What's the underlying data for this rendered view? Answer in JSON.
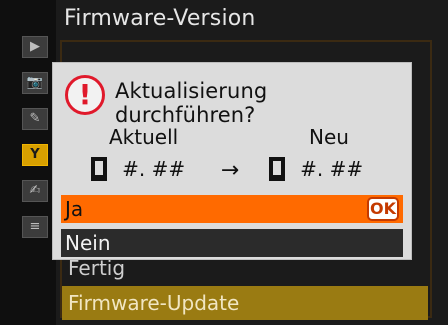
{
  "screen": {
    "title": "Firmware-Version"
  },
  "left_rail": {
    "items": [
      {
        "icon": "playback-icon",
        "symbol": "▶"
      },
      {
        "icon": "camera-icon",
        "symbol": "📷"
      },
      {
        "icon": "pencil-icon",
        "symbol": "✎"
      },
      {
        "icon": "wrench-icon",
        "symbol": "Y"
      },
      {
        "icon": "retouch-icon",
        "symbol": "✍"
      },
      {
        "icon": "my-menu-icon",
        "symbol": "≡"
      }
    ]
  },
  "background_menu": {
    "item_fertig": "Fertig",
    "item_update": "Firmware-Update"
  },
  "dialog": {
    "warning_symbol": "!",
    "title": "Aktualisierung durchführen?",
    "current_label": "Aktuell",
    "new_label": "Neu",
    "current_version": "#. ##",
    "new_version": "#. ##",
    "arrow": "→",
    "options": [
      {
        "label": "Ja",
        "ok": "OK"
      },
      {
        "label": "Nein"
      }
    ]
  },
  "colors": {
    "dialog_bg": "#dcdcdc",
    "selected_option": "#ff6a00",
    "unselected_option": "#2b2b2b",
    "warning": "#e0192b",
    "active_tab": "#d8a000"
  }
}
